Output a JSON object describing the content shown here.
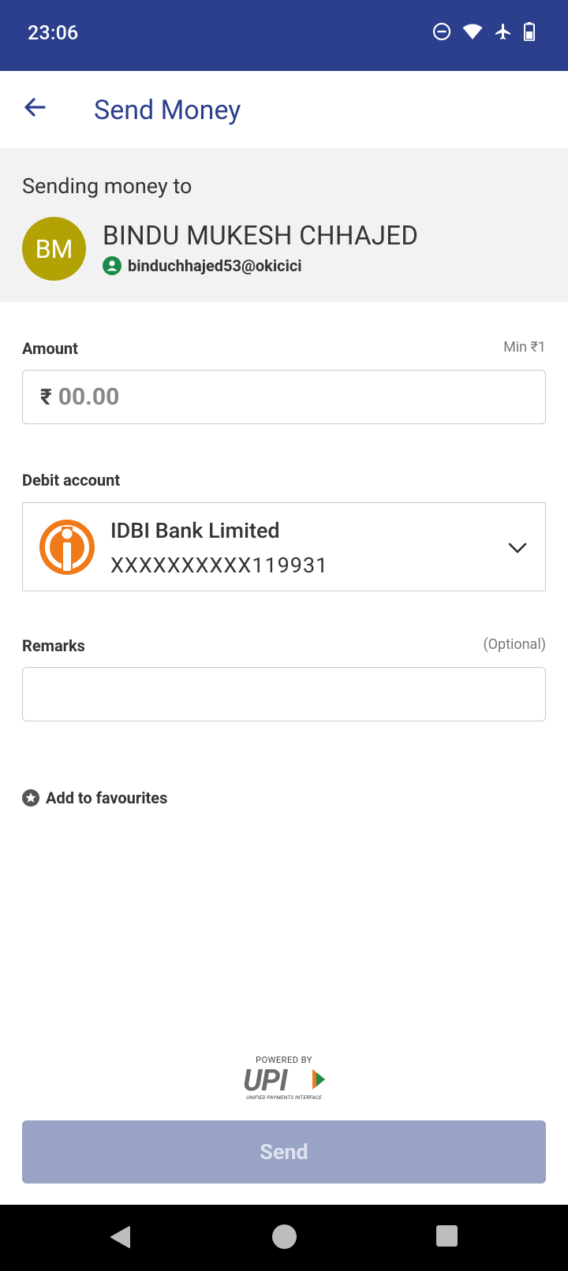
{
  "status_bar": {
    "time": "23:06",
    "icons": [
      "do-not-disturb-icon",
      "wifi-icon",
      "airplane-mode-icon",
      "battery-icon"
    ]
  },
  "app_bar": {
    "title": "Send Money",
    "back_icon": "arrow-left-icon"
  },
  "recipient": {
    "heading": "Sending money to",
    "initials": "BM",
    "name": "BINDU MUKESH CHHAJED",
    "vpa": "binduchhajed53@okicici",
    "avatar_color": "#b3a204",
    "verified_color": "#1b8a4a"
  },
  "amount": {
    "label": "Amount",
    "hint": "Min ₹1",
    "currency_symbol": "₹",
    "placeholder": "00.00"
  },
  "debit_account": {
    "label": "Debit account",
    "bank_name": "IDBI Bank Limited",
    "account_number": "XXXXXXXXXX119931",
    "logo_color": "#f07a1a"
  },
  "remarks": {
    "label": "Remarks",
    "hint": "(Optional)"
  },
  "favourites": {
    "label": "Add to favourites"
  },
  "upi": {
    "powered_by": "POWERED BY",
    "logo_text": "UPI",
    "tagline": "UNIFIED PAYMENTS INTERFACE"
  },
  "send_button": {
    "label": "Send"
  },
  "colors": {
    "primary": "#2c3f8c",
    "send_disabled": "#98a3c6"
  },
  "nav_bar": {
    "icons": [
      "nav-back-icon",
      "nav-home-icon",
      "nav-recents-icon"
    ]
  }
}
